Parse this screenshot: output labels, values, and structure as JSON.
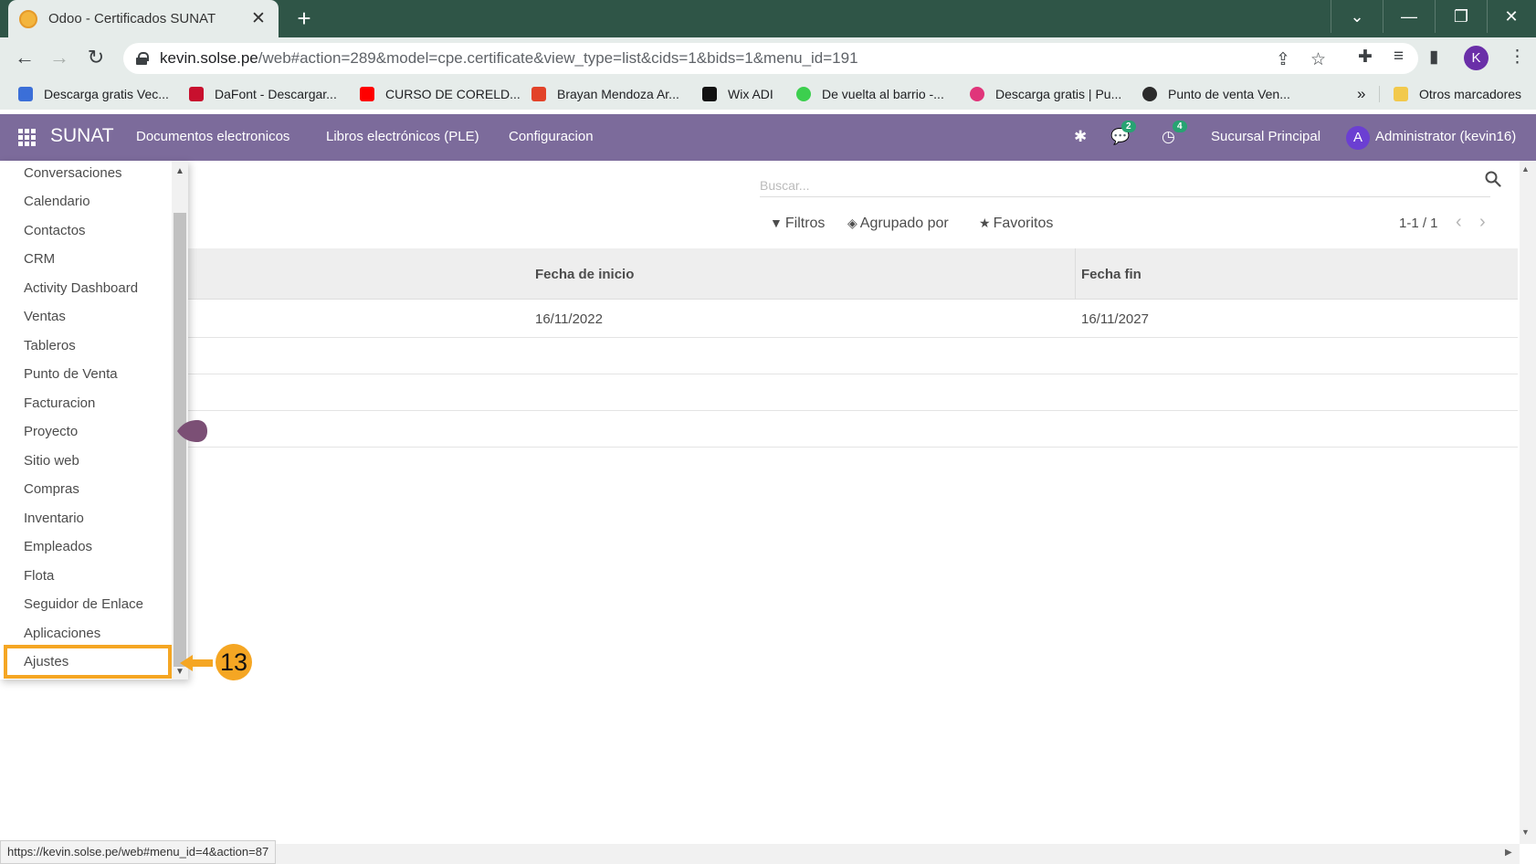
{
  "browser": {
    "tab_title": "Odoo - Certificados SUNAT",
    "new_tab_label": "+",
    "url_host": "kevin.solse.pe",
    "url_path": "/web#action=289&model=cpe.certificate&view_type=list&cids=1&bids=1&menu_id=191",
    "profile_initial": "K",
    "bookmarks": [
      {
        "label": "Descarga gratis Vec...",
        "color": "#3b6fd8"
      },
      {
        "label": "DaFont - Descargar...",
        "color": "#c8102e"
      },
      {
        "label": "CURSO DE CORELD...",
        "color": "#ff0000"
      },
      {
        "label": "Brayan Mendoza Ar...",
        "color": "#e24329"
      },
      {
        "label": "Wix ADI",
        "color": "#111111"
      },
      {
        "label": "De vuelta al barrio -...",
        "color": "#3ccf4e"
      },
      {
        "label": "Descarga gratis | Pu...",
        "color": "#e0357a"
      },
      {
        "label": "Punto de venta Ven...",
        "color": "#2b2b2b"
      }
    ],
    "more_bookmarks": "»",
    "other_bookmarks": "Otros marcadores",
    "status_url": "https://kevin.solse.pe/web#menu_id=4&action=87"
  },
  "odoo": {
    "brand": "SUNAT",
    "menu": [
      "Documentos electronicos",
      "Libros electrónicos (PLE)",
      "Configuracion"
    ],
    "messages_badge": "2",
    "activities_badge": "4",
    "branch": "Sucursal Principal",
    "user_initial": "A",
    "user_name": "Administrator (kevin16)"
  },
  "search": {
    "placeholder": "Buscar...",
    "filters_label": "Filtros",
    "group_by_label": "Agrupado por",
    "favorites_label": "Favoritos",
    "pager": "1-1 / 1"
  },
  "table": {
    "columns": [
      "Fecha de inicio",
      "Fecha fin"
    ],
    "rows": [
      {
        "start": "16/11/2022",
        "end": "16/11/2027"
      }
    ]
  },
  "app_menu": {
    "items": [
      "Conversaciones",
      "Calendario",
      "Contactos",
      "CRM",
      "Activity Dashboard",
      "Ventas",
      "Tableros",
      "Punto de Venta",
      "Facturacion",
      "Proyecto",
      "Sitio web",
      "Compras",
      "Inventario",
      "Empleados",
      "Flota",
      "Seguidor de Enlace",
      "Aplicaciones",
      "Ajustes"
    ]
  },
  "annotation": {
    "step_number": "13",
    "color": "#f5a623"
  }
}
